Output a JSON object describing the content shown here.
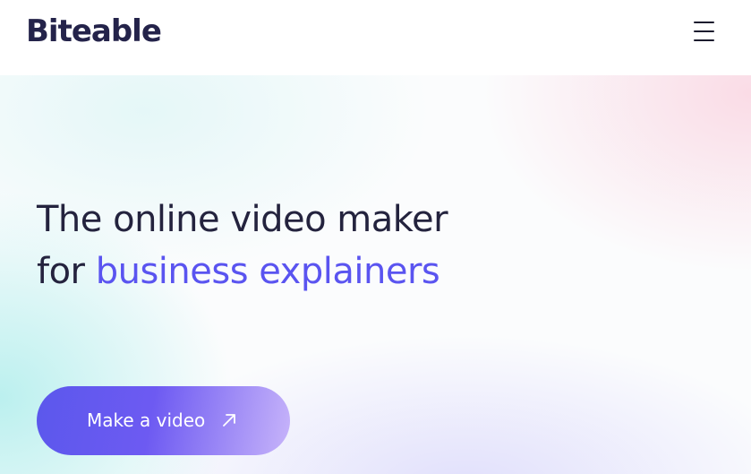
{
  "header": {
    "logo_text": "Biteable",
    "menu_icon": "hamburger-menu-icon"
  },
  "hero": {
    "headline_line1": "The online video maker",
    "headline_line2_prefix": "for ",
    "headline_line2_accent": "business explainers",
    "cta_label": "Make a video",
    "cta_icon": "arrow-up-right-icon"
  },
  "colors": {
    "brand_dark": "#24234a",
    "accent": "#5a54f0",
    "cta_start": "#5b58ec",
    "cta_end": "#c7b4fa"
  }
}
